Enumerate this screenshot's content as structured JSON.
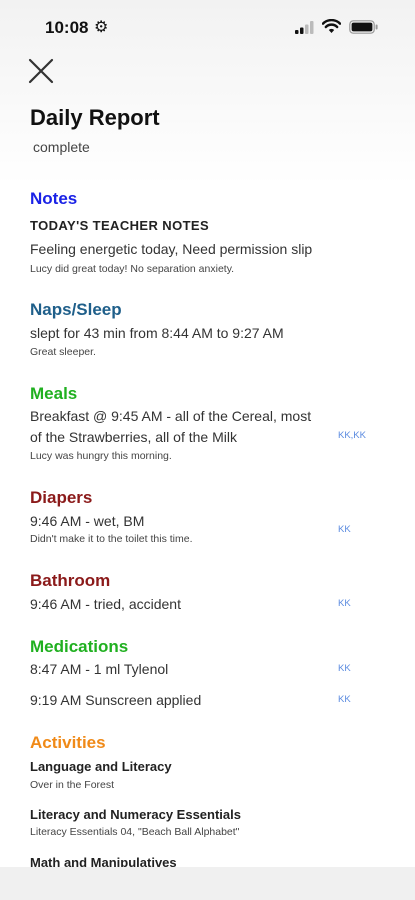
{
  "status": {
    "time": "10:08"
  },
  "header": {
    "title": "Daily Report",
    "subtitle": "complete"
  },
  "notes": {
    "heading": "Notes",
    "subheading": "TODAY'S TEACHER NOTES",
    "text": "Feeling energetic today, Need permission slip",
    "comment": "Lucy did great today!  No separation anxiety."
  },
  "naps": {
    "heading": "Naps/Sleep",
    "text": "slept for 43 min from 8:44 AM to 9:27 AM",
    "comment": "Great sleeper."
  },
  "meals": {
    "heading": "Meals",
    "text_line1": "Breakfast @ 9:45 AM - all of the Cereal, most",
    "text_line2": "of the Strawberries, all of the Milk",
    "initials": "KK,KK",
    "comment": "Lucy was hungry this morning."
  },
  "diapers": {
    "heading": "Diapers",
    "text": "9:46 AM - wet, BM",
    "initials": "KK",
    "comment": "Didn't make it to the toilet this time."
  },
  "bathroom": {
    "heading": "Bathroom",
    "text": "9:46 AM - tried, accident",
    "initials": "KK"
  },
  "medications": {
    "heading": "Medications",
    "items": [
      {
        "text": "8:47 AM  - 1 ml Tylenol",
        "initials": "KK"
      },
      {
        "text": "9:19 AM Sunscreen applied",
        "initials": "KK"
      }
    ]
  },
  "activities": {
    "heading": "Activities",
    "items": [
      {
        "title": "Language and Literacy",
        "detail": "Over in the Forest"
      },
      {
        "title": "Literacy and Numeracy Essentials",
        "detail": "Literacy Essentials 04, \"Beach Ball Alphabet\""
      },
      {
        "title": "Math and Manipulatives",
        "detail": ""
      }
    ]
  },
  "colors": {
    "notes": "#1a22e6",
    "naps": "#1f5f8a",
    "meals": "#20b020",
    "diapers": "#8b1a1a",
    "activities": "#f08a18",
    "initials": "#5b8be0"
  }
}
